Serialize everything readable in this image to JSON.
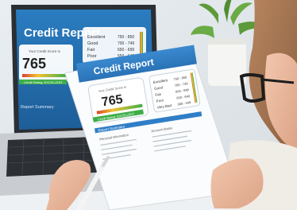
{
  "laptop_screen": {
    "title": "Credit Report",
    "gauge_label": "Your Credit Score is",
    "score": "765",
    "rating_label": "Credit Rating: EXCELLENT",
    "summary_label": "Report Summary",
    "legend": [
      {
        "label": "Excellent",
        "range": "750 - 850"
      },
      {
        "label": "Good",
        "range": "700 - 749"
      },
      {
        "label": "Fair",
        "range": "650 - 699"
      },
      {
        "label": "Poor",
        "range": "550 - 649"
      }
    ]
  },
  "paper_report": {
    "title": "Credit Report",
    "gauge_label": "Your Credit Score is",
    "score": "765",
    "rating_label": "Credit Rating: EXCELLENT",
    "summary_label": "Report Summary",
    "legend": [
      {
        "label": "Excellent",
        "range": "750 - 850"
      },
      {
        "label": "Good",
        "range": "700 - 749"
      },
      {
        "label": "Fair",
        "range": "650 - 699"
      },
      {
        "label": "Poor",
        "range": "550 - 649"
      },
      {
        "label": "Very Bad",
        "range": "300 - 549"
      }
    ],
    "section_left": "Personal Information",
    "section_right": "Account Status"
  },
  "colors": {
    "screen_blue": "#1f6fb4",
    "paper_blue": "#2f7ec7",
    "gauge_green": "#3fae49",
    "gauge_yellow": "#f2c230",
    "gauge_red": "#d9432c",
    "plant_green": "#5c9a3a"
  }
}
